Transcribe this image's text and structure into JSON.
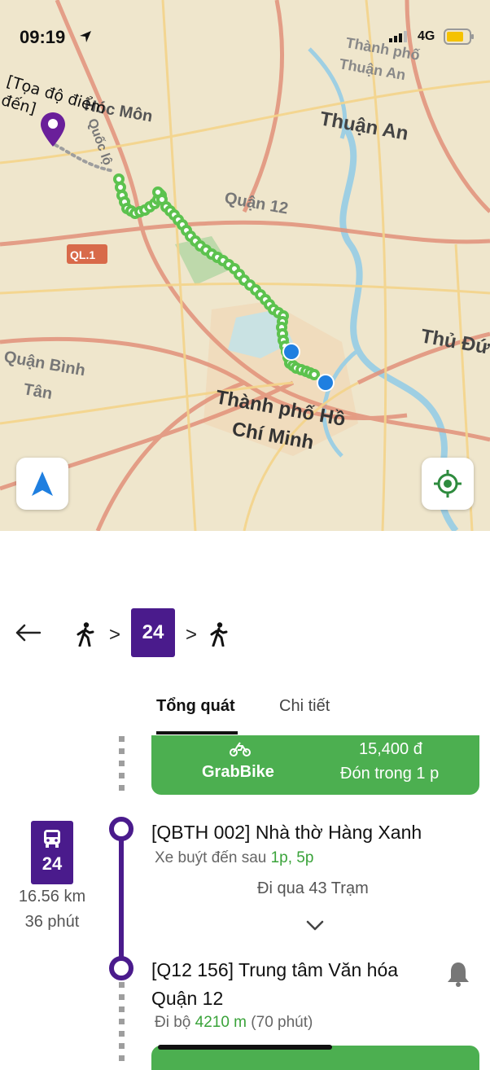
{
  "status_bar": {
    "time": "09:19",
    "network": "4G",
    "battery_color": "#f5c200"
  },
  "map": {
    "labels": {
      "hoc_mon": "Hóc Môn",
      "quoc_lo": "Quốc lộ",
      "thanh_pho_thuan_an_1": "Thành phố",
      "thanh_pho_thuan_an_2": "Thuận An",
      "thuan_an": "Thuận An",
      "quan_12": "Quận 12",
      "ql1": "QL.1",
      "quan_binh_tan_1": "Quận Bình",
      "quan_binh_tan_2": "Tân",
      "thu_duc": "Thủ Đức",
      "hcm_1": "Thành phố Hồ",
      "hcm_2": "Chí Minh"
    },
    "destination_label": "[Tọa độ điểm đến]",
    "route_color": "#5cc24e",
    "walk_color": "#9e9e9e",
    "accent_color": "#4a1b8c",
    "my_location_color": "#1f7fe0",
    "buttons": {
      "compass_icon": "navigation-arrow-icon",
      "locate_icon": "locate-me-icon"
    }
  },
  "route_header": {
    "back_icon": "back-arrow-icon",
    "steps": [
      {
        "type": "walk",
        "icon": "walking-person-icon"
      },
      {
        "type": "bus",
        "label": "24"
      },
      {
        "type": "walk",
        "icon": "walking-person-icon"
      }
    ],
    "separator": ">"
  },
  "tabs": {
    "overview": "Tổng quát",
    "details": "Chi tiết",
    "active": "overview"
  },
  "grab_card": {
    "service": "GrabBike",
    "price": "15,400 đ",
    "pickup": "Đón trong 1 p",
    "color": "#4caf50"
  },
  "bus_leg": {
    "route_number": "24",
    "distance": "16.56 km",
    "duration": "36 phút",
    "from_stop": "[QBTH 002] Nhà thờ Hàng Xanh",
    "arrival_prefix": "Xe buýt đến sau ",
    "arrival_times": "1p, 5p",
    "stops_passed": "Đi qua 43 Trạm",
    "to_stop": "[Q12 156] Trung tâm Văn hóa Quận 12",
    "walk_prefix": "Đi bộ ",
    "walk_distance": "4210 m",
    "walk_duration": " (70 phút)"
  }
}
